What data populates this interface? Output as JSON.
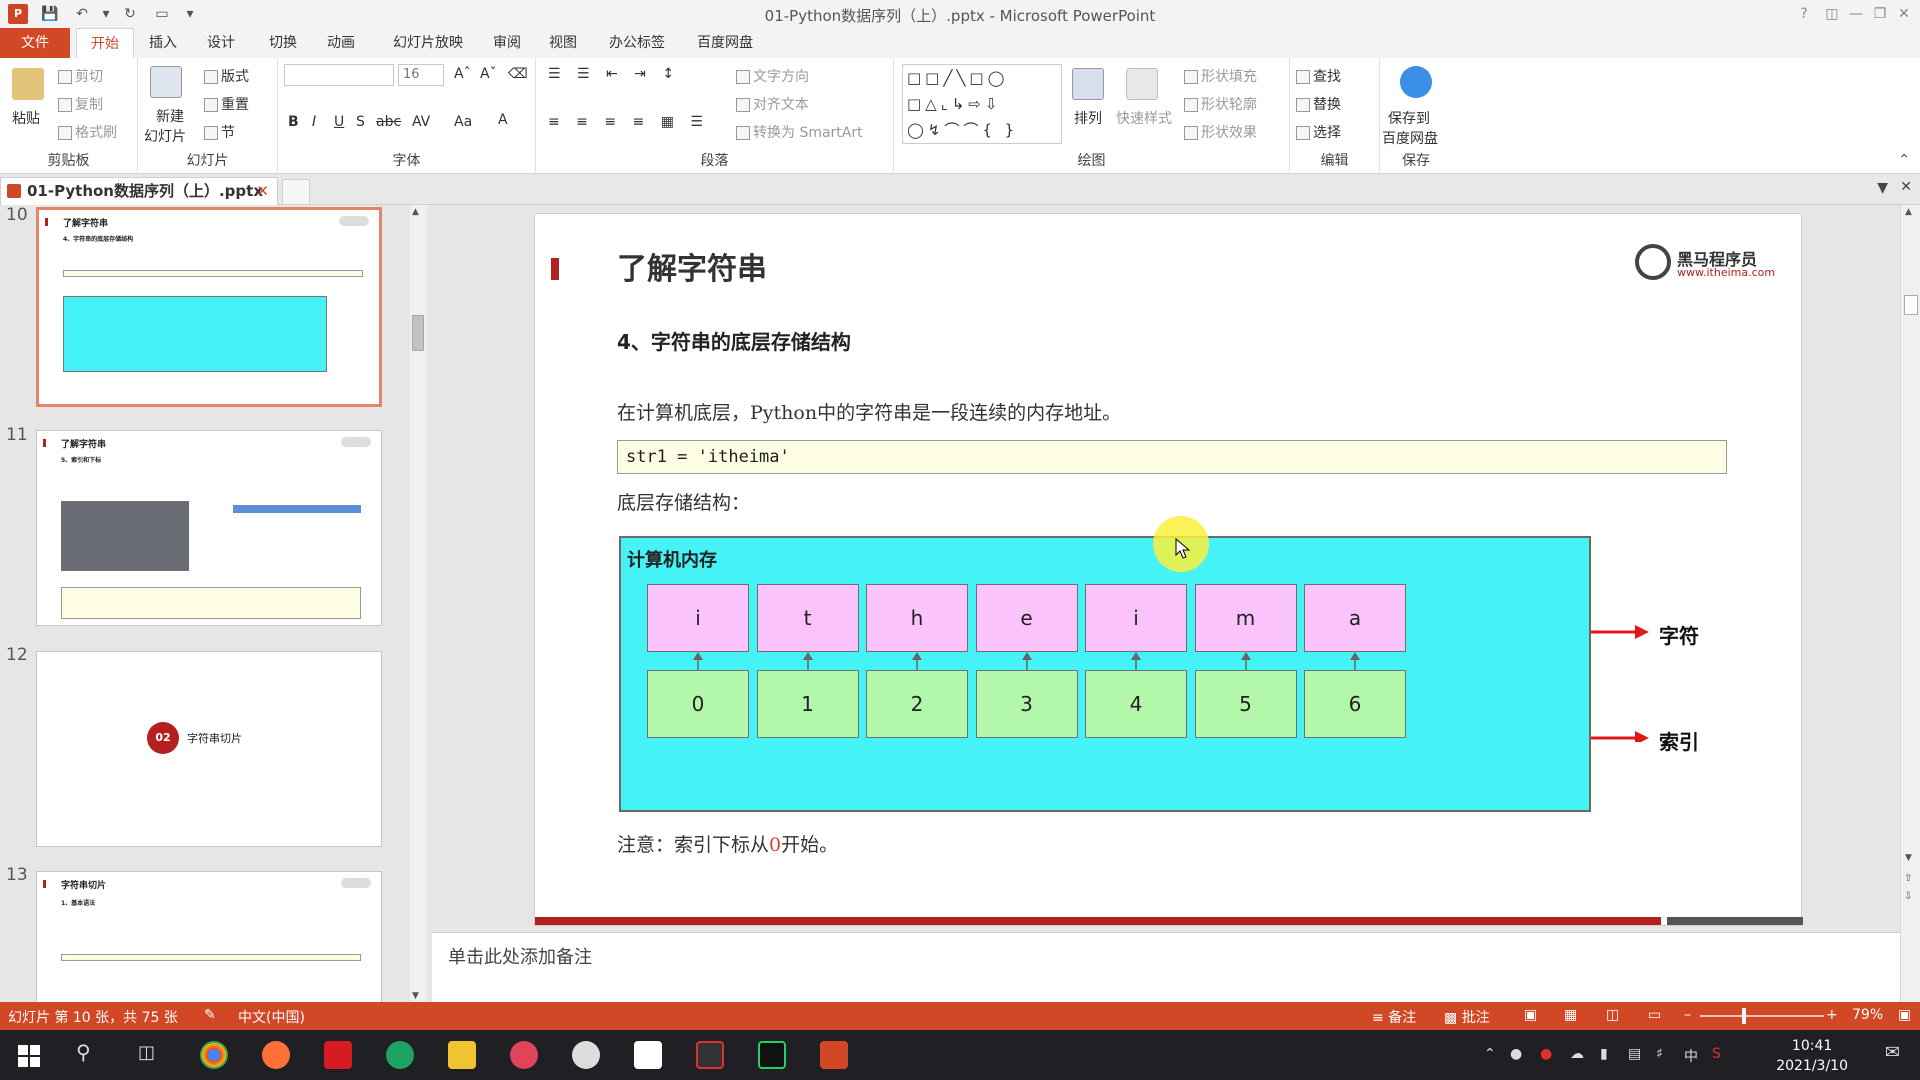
{
  "window": {
    "title": "01-Python数据序列（上）.pptx - Microsoft PowerPoint",
    "app_icon": "P"
  },
  "tabs": [
    "文件",
    "开始",
    "插入",
    "设计",
    "切换",
    "动画",
    "幻灯片放映",
    "审阅",
    "视图",
    "办公标签",
    "百度网盘"
  ],
  "active_tab": "开始",
  "ribbon": {
    "clipboard": {
      "paste": "粘贴",
      "cut": "剪切",
      "copy": "复制",
      "format_painter": "格式刷",
      "label": "剪贴板"
    },
    "slides": {
      "new_slide": "新建",
      "new_slide2": "幻灯片",
      "layout": "版式",
      "reset": "重置",
      "section": "节",
      "label": "幻灯片"
    },
    "font": {
      "size": "16",
      "label": "字体",
      "b": "B",
      "i": "I",
      "u": "U",
      "s": "S",
      "abc": "abc",
      "av": "AV",
      "aa": "Aa",
      "a": "A"
    },
    "paragraph": {
      "text_direction": "文字方向",
      "align_text": "对齐文本",
      "smartart": "转换为 SmartArt",
      "label": "段落"
    },
    "drawing": {
      "arrange": "排列",
      "quick_styles": "快速样式",
      "shape_fill": "形状填充",
      "shape_outline": "形状轮廓",
      "shape_effects": "形状效果",
      "label": "绘图"
    },
    "editing": {
      "find": "查找",
      "replace": "替换",
      "select": "选择",
      "label": "编辑"
    },
    "save": {
      "line1": "保存到",
      "line2": "百度网盘",
      "label": "保存"
    }
  },
  "doc_tab": "01-Python数据序列（上）.pptx",
  "thumbnails": [
    {
      "num": "10",
      "title": "了解字符串",
      "sub": "4、字符串的底层存储结构"
    },
    {
      "num": "11",
      "title": "了解字符串",
      "sub": "5、索引和下标"
    },
    {
      "num": "12",
      "badge": "02",
      "caption": "字符串切片"
    },
    {
      "num": "13",
      "title": "字符串切片",
      "sub": "1、基本语法"
    }
  ],
  "slide": {
    "title": "了解字符串",
    "logo_cn": "黑马程序员",
    "logo_url": "www.itheima.com",
    "subtitle": "4、字符串的底层存储结构",
    "para": "在计算机底层，Python中的字符串是一段连续的内存地址。",
    "code": "str1 = 'itheima'",
    "struct_label": "底层存储结构：",
    "memory_label": "计算机内存",
    "chars": [
      "i",
      "t",
      "h",
      "e",
      "i",
      "m",
      "a"
    ],
    "indexes": [
      "0",
      "1",
      "2",
      "3",
      "4",
      "5",
      "6"
    ],
    "char_label": "字符",
    "index_label": "索引",
    "note_prefix": "注意：索引下标从",
    "note_zero": "0",
    "note_suffix": "开始。"
  },
  "notes_placeholder": "单击此处添加备注",
  "status": {
    "slide_info": "幻灯片 第 10 张，共 75 张",
    "language": "中文(中国)",
    "notes": "备注",
    "comments": "批注",
    "zoom": "79%"
  },
  "clock": {
    "time": "10:41",
    "date": "2021/3/10"
  },
  "colors": {
    "accent": "#d24726",
    "memory_bg": "#45f3f7",
    "char_cell": "#fbc3fb",
    "index_cell": "#b3f7aa",
    "brand_red": "#b3201f"
  }
}
